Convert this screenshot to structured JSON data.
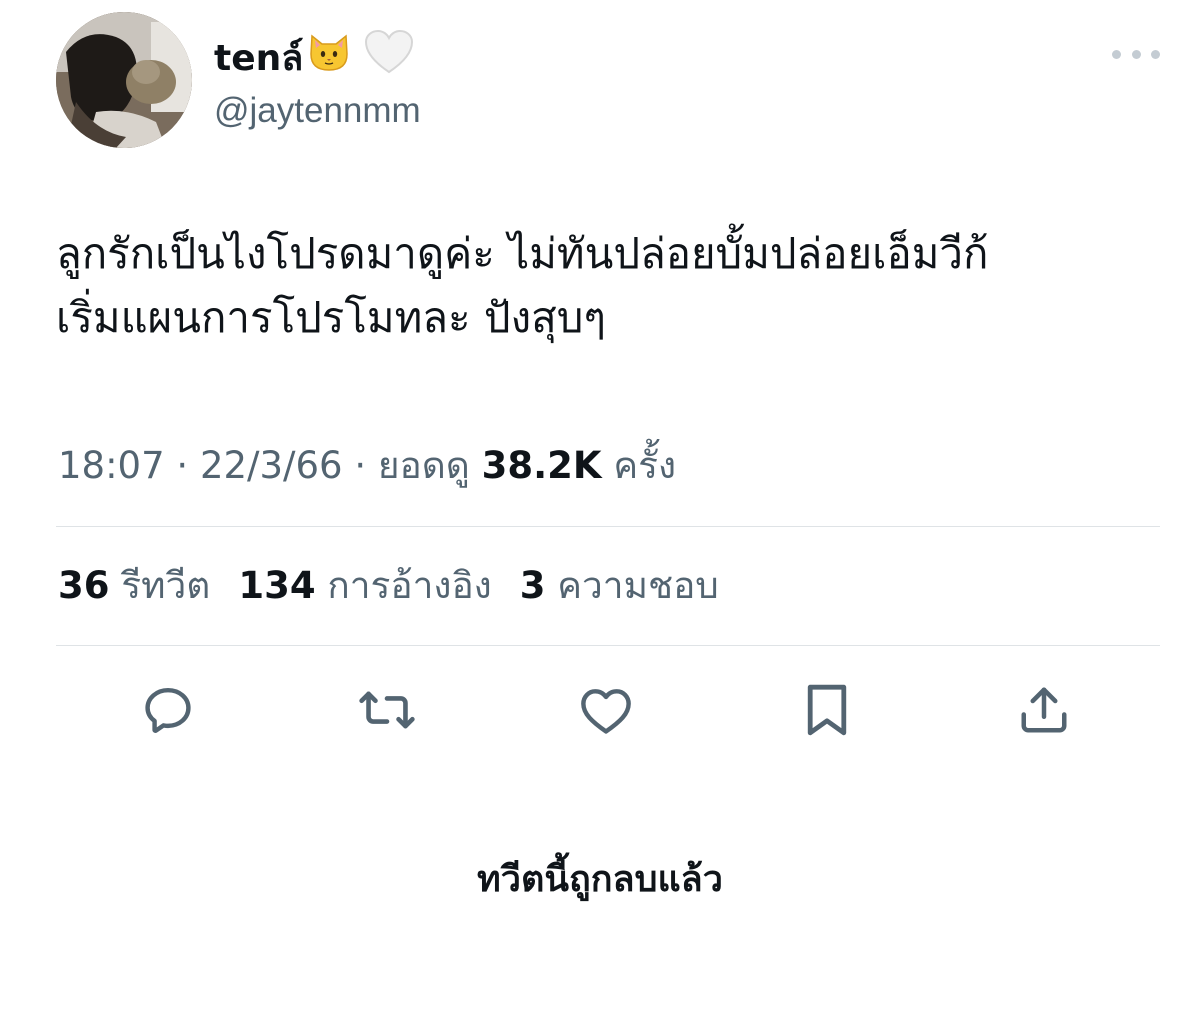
{
  "user": {
    "display_name": "tenล์",
    "handle": "@jaytennmm"
  },
  "tweet": {
    "lines": [
      "ลูกรักเป็นไงโปรดมาดูค่ะ ไม่ทันปล่อยบั้มปล่อยเอ็มวีก้",
      "เริ่มแผนการโปรโมทละ ปังสุบๆ"
    ],
    "time": "18:07",
    "date": "22/3/66",
    "views_label": "ยอดดู",
    "views_count": "38.2K",
    "views_suffix": "ครั้ง",
    "separator": "·"
  },
  "stats": {
    "retweets_count": "36",
    "retweets_label": "รีทวีต",
    "quotes_count": "134",
    "quotes_label": "การอ้างอิง",
    "likes_count": "3",
    "likes_label": "ความชอบ"
  },
  "icons": [
    "reply-icon",
    "retweet-icon",
    "like-icon",
    "bookmark-icon",
    "share-icon"
  ],
  "notice": "ทวีตนี้ถูกลบแล้ว",
  "colors": {
    "text": "#0f1419",
    "secondary": "#536471",
    "icon": "#536471",
    "divider": "#dfe3e6"
  }
}
